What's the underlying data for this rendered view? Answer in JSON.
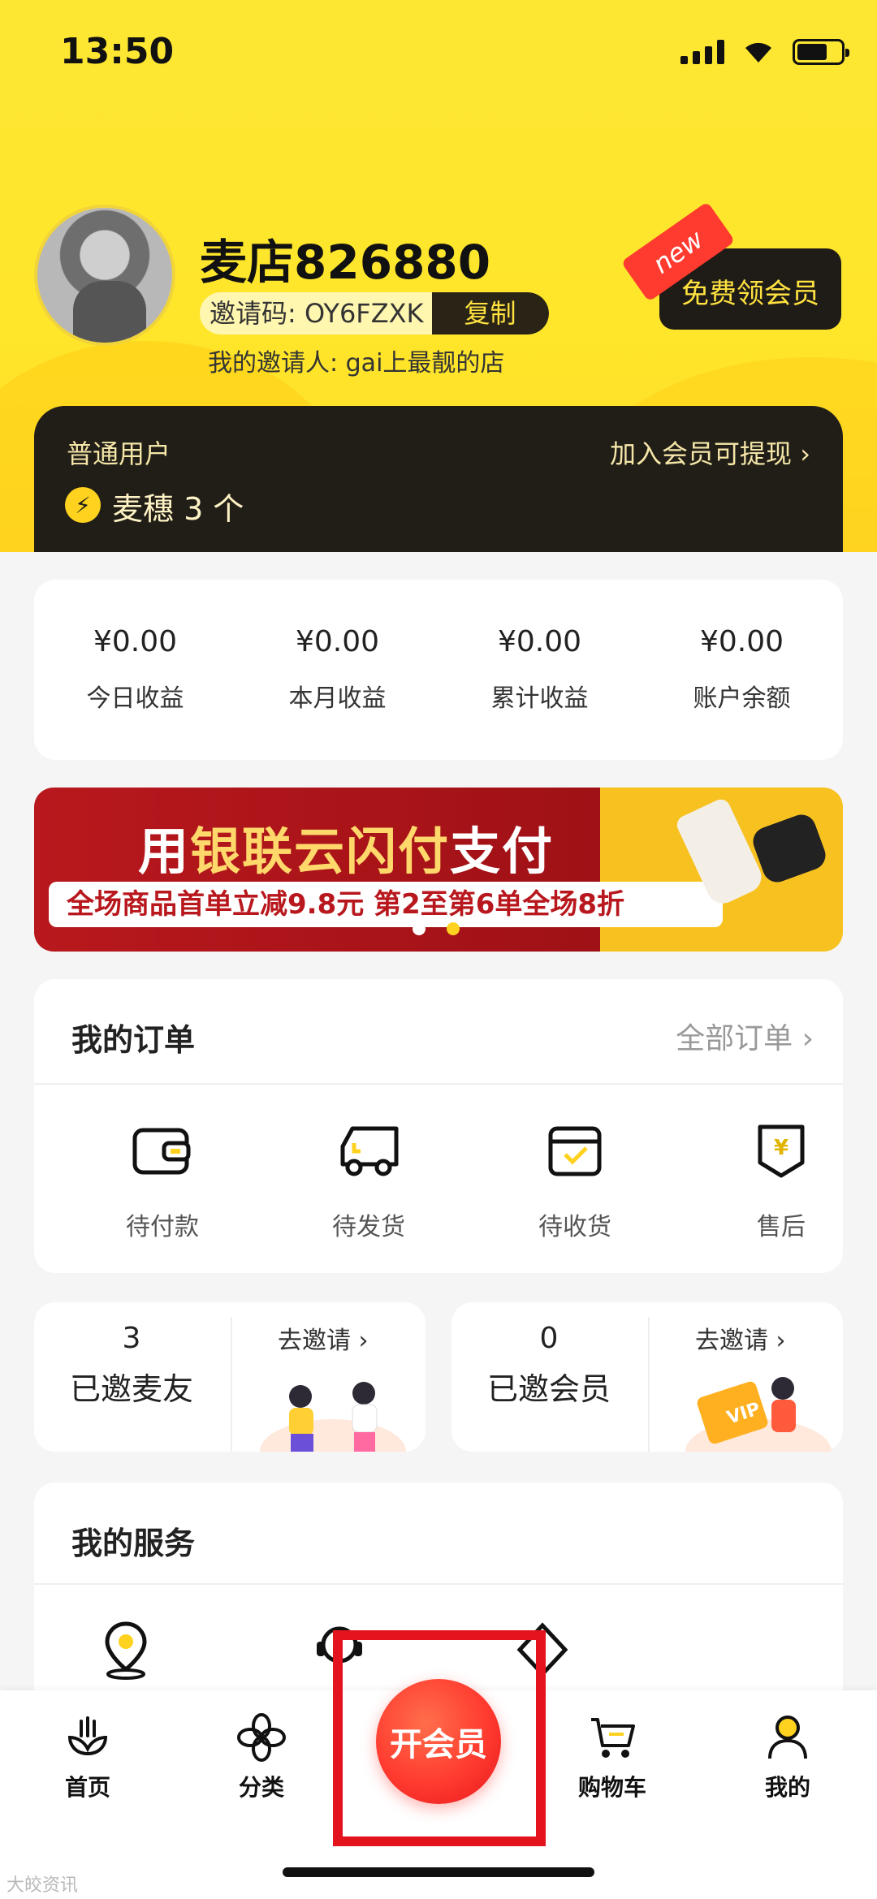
{
  "status_bar": {
    "time": "13:50"
  },
  "profile": {
    "username": "麦店826880",
    "invite_code_label": "邀请码: OY6FZXK",
    "copy_label": "复制",
    "inviter": "我的邀请人: gai上最靓的店",
    "free_vip_label": "免费领会员",
    "new_tag": "new"
  },
  "member_card": {
    "level": "普通用户",
    "join_link": "加入会员可提现",
    "points": "麦穗 3 个"
  },
  "earnings": [
    {
      "value": "¥0.00",
      "label": "今日收益"
    },
    {
      "value": "¥0.00",
      "label": "本月收益"
    },
    {
      "value": "¥0.00",
      "label": "累计收益"
    },
    {
      "value": "¥0.00",
      "label": "账户余额"
    }
  ],
  "banner": {
    "headline_part1": "用",
    "headline_gold": "银联云闪付",
    "headline_part2": "支付",
    "subline": "全场商品首单立减9.8元  第2至第6单全场8折",
    "active_dot": 2,
    "dot_count": 2
  },
  "orders": {
    "title": "我的订单",
    "all_link": "全部订单",
    "items": [
      {
        "label": "待付款",
        "icon": "wallet-icon"
      },
      {
        "label": "待发货",
        "icon": "truck-icon"
      },
      {
        "label": "待收货",
        "icon": "package-check-icon"
      },
      {
        "label": "售后",
        "icon": "yuan-shield-icon"
      }
    ]
  },
  "invites": [
    {
      "count": "3",
      "label": "已邀麦友",
      "action": "去邀请"
    },
    {
      "count": "0",
      "label": "已邀会员",
      "action": "去邀请"
    }
  ],
  "services": {
    "title": "我的服务"
  },
  "tabbar": {
    "items": [
      {
        "label": "首页",
        "icon": "home-sprout-icon"
      },
      {
        "label": "分类",
        "icon": "category-flower-icon"
      },
      {
        "label": "购物车",
        "icon": "cart-icon"
      },
      {
        "label": "我的",
        "icon": "user-icon"
      }
    ],
    "center_button": "开会员",
    "active": "我的"
  },
  "watermark": "大皎资讯",
  "colors": {
    "brand_yellow": "#ffe62a",
    "dark": "#211e18",
    "accent_red": "#ff3b2f",
    "gold": "#ffe240"
  }
}
